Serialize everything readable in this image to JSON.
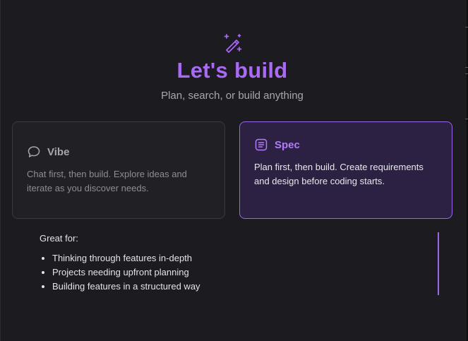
{
  "hero": {
    "icon": "magic-wand-sparkles-icon",
    "title": "Let's build",
    "subtitle": "Plan, search, or build anything"
  },
  "modes": {
    "vibe": {
      "icon": "chat-bubble-icon",
      "label": "Vibe",
      "description": "Chat first, then build. Explore ideas and iterate as you discover needs."
    },
    "spec": {
      "icon": "document-list-icon",
      "label": "Spec",
      "description": "Plan first, then build. Create requirements and design before coding starts.",
      "selected": true
    }
  },
  "details": {
    "heading": "Great for:",
    "items": [
      "Thinking through features in-depth",
      "Projects needing upfront planning",
      "Building features in a structured way"
    ]
  },
  "colors": {
    "background": "#1c1b20",
    "accent": "#a96bf5",
    "selected_card_bg": "#2d2143",
    "selected_card_border": "#9a66ea"
  }
}
